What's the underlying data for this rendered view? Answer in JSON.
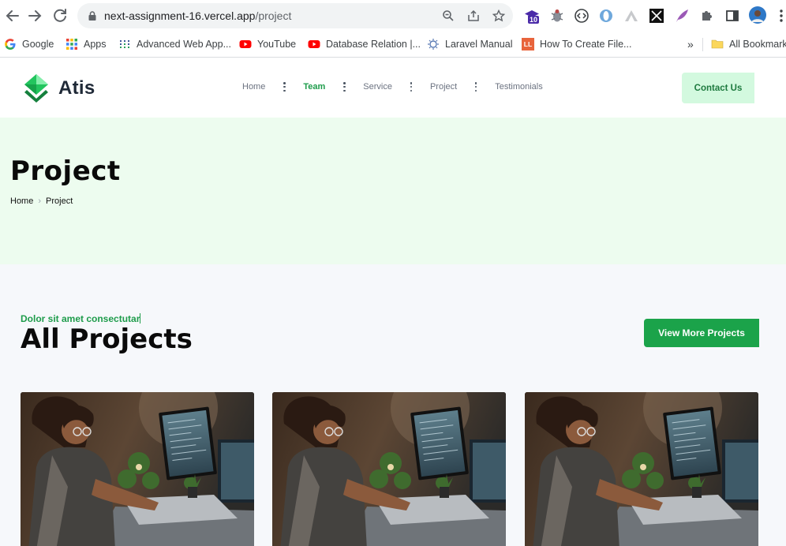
{
  "browser": {
    "url_host": "next-assignment-16.vercel.app",
    "url_path": "/project",
    "extension_badge": "10",
    "bookmarks": [
      {
        "label": "Google",
        "icon": "google-icon"
      },
      {
        "label": "Apps",
        "icon": "apps-grid-icon"
      },
      {
        "label": "Advanced Web App...",
        "icon": "dots-grid-icon"
      },
      {
        "label": "YouTube",
        "icon": "youtube-icon"
      },
      {
        "label": "Database Relation |...",
        "icon": "youtube-icon"
      },
      {
        "label": "Laravel Manual",
        "icon": "bulb-icon"
      },
      {
        "label": "How To Create File...",
        "icon": "ll-icon"
      }
    ],
    "overflow": "»",
    "all_bookmarks": "All Bookmarks",
    "ll_icon_text": "LL"
  },
  "site": {
    "brand": "Atis",
    "menu": [
      {
        "label": "Home",
        "active": false
      },
      {
        "label": "Team",
        "active": true
      },
      {
        "label": "Service",
        "active": false
      },
      {
        "label": "Project",
        "active": false
      },
      {
        "label": "Testimonials",
        "active": false
      }
    ],
    "contact_label": "Contact Us"
  },
  "hero": {
    "title": "Project",
    "breadcrumb": [
      "Home",
      "Project"
    ]
  },
  "projects": {
    "eyebrow": "Dolor sit amet consectutar",
    "title": "All Projects",
    "more_label": "View More Projects",
    "cards": [
      {
        "image": "woman-coding-at-desk-photo"
      },
      {
        "image": "woman-coding-at-desk-photo"
      },
      {
        "image": "woman-coding-at-desk-photo"
      }
    ]
  },
  "colors": {
    "accent": "#1ba34a",
    "hero_bg": "#edfcef",
    "contact_bg": "#d3f9df"
  }
}
